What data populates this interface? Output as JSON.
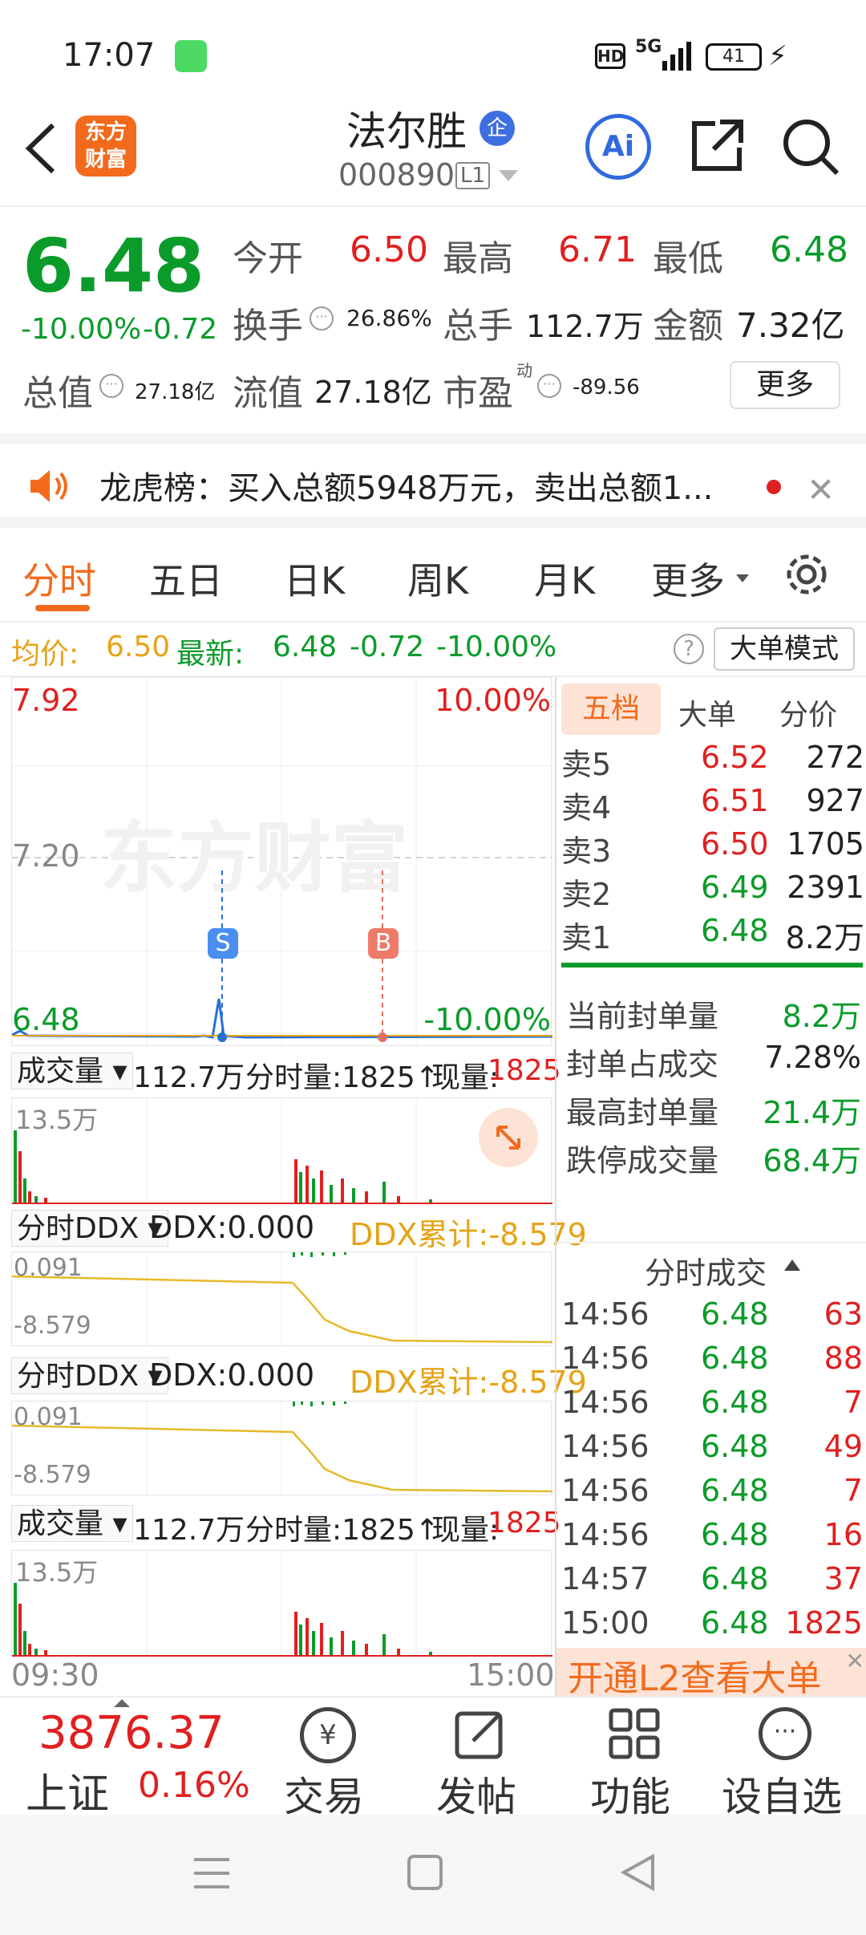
{
  "status_bar": {
    "time": "17:07",
    "net": "5G",
    "battery": "41"
  },
  "header": {
    "stock_name": "法尔胜",
    "stock_code": "000890",
    "level": "L1",
    "logo_text_1": "东方",
    "logo_text_2": "财富",
    "ai_label": "Ai",
    "qi_badge": "企"
  },
  "quote": {
    "price": "6.48",
    "change_pct": "-10.00%",
    "change": "-0.72",
    "open_label": "今开",
    "open": "6.50",
    "high_label": "最高",
    "high": "6.71",
    "low_label": "最低",
    "low": "6.48",
    "turnover_label": "换手",
    "turnover": "26.86%",
    "volume_label": "总手",
    "volume": "112.7万",
    "amount_label": "金额",
    "amount": "7.32亿",
    "mcap_label": "总值",
    "mcap": "27.18亿",
    "float_label": "流值",
    "float": "27.18亿",
    "pe_label": "市盈",
    "pe_sup": "动",
    "pe": "-89.56",
    "more_button": "更多"
  },
  "notice": {
    "text": "龙虎榜：买入总额5948万元，卖出总额1..."
  },
  "tabs": [
    "分时",
    "五日",
    "日K",
    "周K",
    "月K",
    "更多"
  ],
  "avg_bar": {
    "avg_label": "均价:",
    "avg": "6.50",
    "last_label": "最新:",
    "last": "6.48",
    "chg": "-0.72",
    "pct": "-10.00%",
    "big_order_button": "大单模式"
  },
  "chart": {
    "ymax": "7.92",
    "ymax_pct": "10.00%",
    "ymid": "7.20",
    "ymin": "6.48",
    "ymin_pct": "-10.00%",
    "watermark": "东方财富",
    "marker_s": "S",
    "marker_b": "B",
    "x_start": "09:30",
    "x_end": "15:00"
  },
  "vol_panel": {
    "label": "成交量",
    "total": "112.7万",
    "fenshi_label": "分时量:1825↑",
    "xianliang_label": "现量:",
    "xianliang": "1825",
    "ymax": "13.5万"
  },
  "ddx_panel": {
    "label": "分时DDX",
    "ddx": "DDX:0.000",
    "ddx_cum": "DDX累计:-8.579",
    "ymax": "0.091",
    "ymin": "-8.579"
  },
  "orderbook": {
    "tabs": [
      "五档",
      "大单",
      "分价"
    ],
    "asks": [
      {
        "label": "卖5",
        "price": "6.52",
        "vol": "272"
      },
      {
        "label": "卖4",
        "price": "6.51",
        "vol": "927"
      },
      {
        "label": "卖3",
        "price": "6.50",
        "vol": "1705"
      },
      {
        "label": "卖2",
        "price": "6.49",
        "vol": "2391"
      },
      {
        "label": "卖1",
        "price": "6.48",
        "vol": "8.2万"
      }
    ],
    "stats": [
      {
        "label": "当前封单量",
        "value": "8.2万"
      },
      {
        "label": "封单占成交",
        "value": "7.28%"
      },
      {
        "label": "最高封单量",
        "value": "21.4万"
      },
      {
        "label": "跌停成交量",
        "value": "68.4万"
      }
    ]
  },
  "ticks": {
    "title": "分时成交",
    "rows": [
      {
        "t": "14:56",
        "p": "6.48",
        "v": "63"
      },
      {
        "t": "14:56",
        "p": "6.48",
        "v": "88"
      },
      {
        "t": "14:56",
        "p": "6.48",
        "v": "7"
      },
      {
        "t": "14:56",
        "p": "6.48",
        "v": "49"
      },
      {
        "t": "14:56",
        "p": "6.48",
        "v": "7"
      },
      {
        "t": "14:56",
        "p": "6.48",
        "v": "16"
      },
      {
        "t": "14:57",
        "p": "6.48",
        "v": "37"
      },
      {
        "t": "15:00",
        "p": "6.48",
        "v": "1825"
      }
    ],
    "l2_banner": "开通L2查看大单"
  },
  "bottom": {
    "index_value": "3876.37",
    "index_name": "上证",
    "index_pct": "0.16%",
    "items": [
      "交易",
      "发帖",
      "功能",
      "设自选"
    ]
  },
  "colors": {
    "up": "#e02020",
    "down": "#0a9b2a",
    "avg": "#e6a317",
    "accent": "#f26b1d",
    "price_line": "#2a6fd6"
  }
}
